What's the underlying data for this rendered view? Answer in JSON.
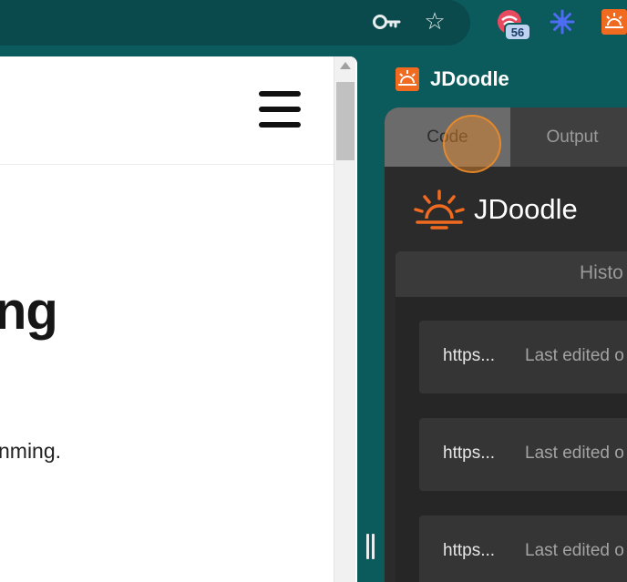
{
  "toolbar": {
    "extension_badge": "56",
    "icons": [
      "key-icon",
      "star-icon",
      "extension-icon",
      "sparkle-icon",
      "jdoodle-logo-icon"
    ]
  },
  "page": {
    "heading_fragment": "ng",
    "text_fragment": "nming."
  },
  "panel": {
    "title": "JDoodle",
    "tabs": [
      {
        "label": "Code"
      },
      {
        "label": "Output"
      }
    ],
    "brand_name": "JDoodle",
    "history_label": "Histo",
    "history_items": [
      {
        "url": "https...",
        "time": "Last edited o"
      },
      {
        "url": "https...",
        "time": "Last edited o"
      },
      {
        "url": "https...",
        "time": "Last edited o"
      }
    ]
  },
  "colors": {
    "accent": "#f06a1f",
    "chrome": "#0b5a5c",
    "panel_bg": "#2b2b2b"
  }
}
